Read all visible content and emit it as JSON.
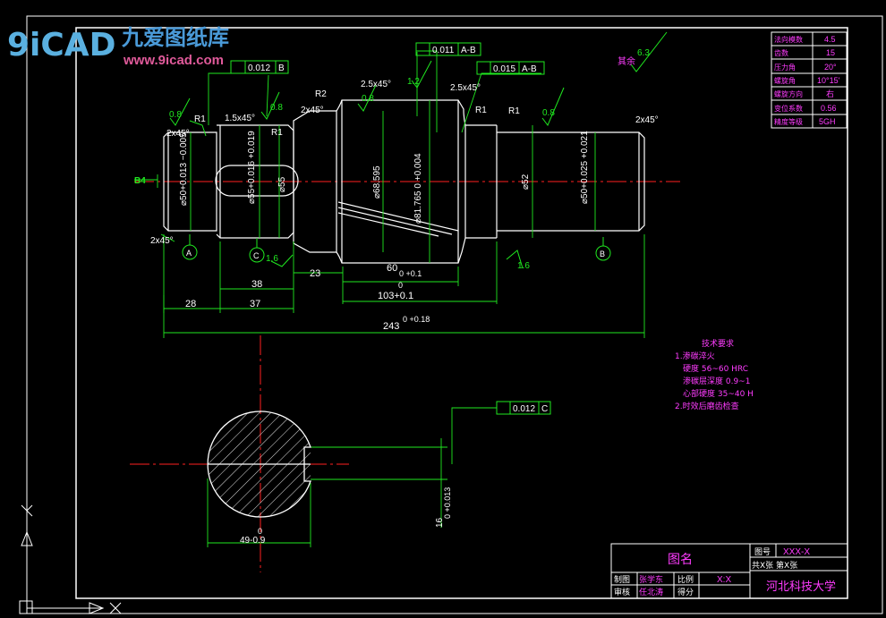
{
  "logo": {
    "glyph": "9iCAD",
    "title": "九爱图纸库",
    "url": "www.9icad.com"
  },
  "roughness": {
    "general_label": "其余",
    "general_value": "6.3",
    "r1": "0.8",
    "r2": "0.8",
    "r3": "0.8",
    "r4": "1.2",
    "r5": "0.8",
    "r6": "0.8",
    "r7": "1.6",
    "r8": "1.6"
  },
  "tolerances": {
    "runout_1_value": "0.011",
    "runout_1_ref": "A-B",
    "runout_2_value": "0.015",
    "runout_2_ref": "A-B",
    "concentricity_value": "0.012",
    "concentricity_ref": "B",
    "symmetry_value": "0.012",
    "symmetry_ref": "C"
  },
  "dims": {
    "chamfer_left_top": "2x45°",
    "chamfer_left_bottom": "2x45°",
    "chamfer_right": "2x45°",
    "chamfer_1": "1.5x45°",
    "chamfer_2": "2x45°",
    "chamfer_3": "2.5x45°",
    "chamfer_4": "2.5x45°",
    "r1_a": "R1",
    "r1_b": "R1",
    "r1_c": "R1",
    "r1_d": "R1",
    "r2": "R2",
    "dia_left": "⌀50+0.013 −0.005",
    "dia_keyway": "⌀55+0.016 +0.019",
    "dia_55": "⌀55",
    "dia_gear": "⌀68.595",
    "dia_root": "⌀81.765 0 +0.004",
    "dia_52": "⌀52",
    "dia_right": "⌀50+0.025 +0.021",
    "datum_label_side": "B4",
    "len_28": "28",
    "len_37": "37",
    "len_38": "38",
    "len_23": "23",
    "len_60": "60",
    "len_60_tol": "0 +0.1",
    "len_103": "103+0.1",
    "len_103_tol": "0",
    "len_243": "243",
    "len_243_tol": "0 +0.18",
    "sec_width": "49-0.9",
    "sec_width_tol": "0",
    "sec_depth": "16",
    "sec_depth_tol": "0 +0.013"
  },
  "datums": {
    "a": "A",
    "b": "B",
    "c": "C"
  },
  "gear_table": {
    "rows": [
      {
        "label": "法向模数",
        "value": "4.5"
      },
      {
        "label": "齿数",
        "value": "15"
      },
      {
        "label": "压力角",
        "value": "20°"
      },
      {
        "label": "螺旋角",
        "value": "10°15'"
      },
      {
        "label": "螺旋方向",
        "value": "右"
      },
      {
        "label": "变位系数",
        "value": "0.56"
      },
      {
        "label": "精度等级",
        "value": "5GH"
      }
    ]
  },
  "tech_req": {
    "title": "技术要求",
    "lines": [
      "1.渗碳淬火",
      "硬度 56~60  HRC",
      "渗碳层深度 0.9~1",
      "心部硬度 35~40  H",
      "2.时效后磨齿检查"
    ]
  },
  "title_block": {
    "drawing_name": "图名",
    "code_label": "图号",
    "code_value": "XXX-X",
    "sheets_text": "共X张  第X张",
    "drawn_label": "制图",
    "drawn_name": "张学东",
    "ratio_label": "比例",
    "ratio_value": "X:X",
    "check_label": "审核",
    "check_name": "任北涛",
    "grade_label": "得分",
    "school": "河北科技大学"
  }
}
